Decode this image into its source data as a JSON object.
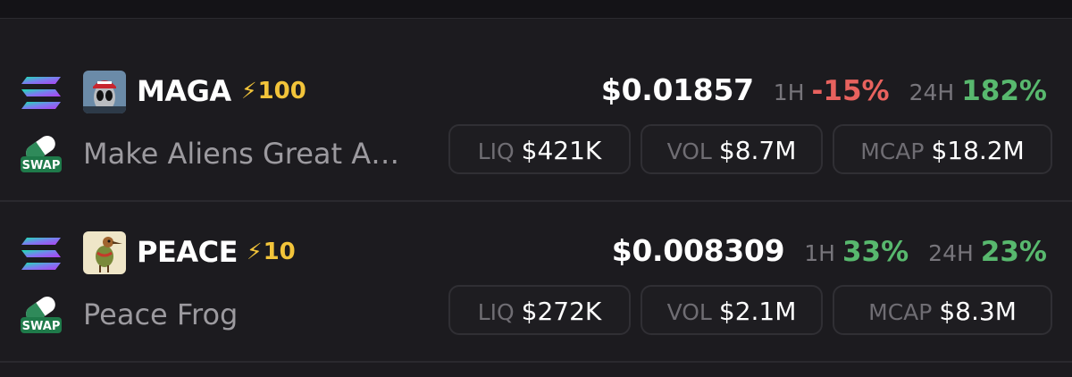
{
  "tokens": [
    {
      "chain_icon": "solana-icon",
      "swap_icon": "swap-pill-icon",
      "swap_label": "SWAP",
      "avatar": "alien-avatar",
      "ticker": "MAGA",
      "boost": "100",
      "name": "Make Aliens Great A…",
      "price": "$0.01857",
      "h1_label": "1H",
      "h1_change": "-15%",
      "h24_label": "24H",
      "h24_change": "182%",
      "liq_label": "LIQ",
      "liq": "$421K",
      "vol_label": "VOL",
      "vol": "$8.7M",
      "mcap_label": "MCAP",
      "mcap": "$18.2M"
    },
    {
      "chain_icon": "solana-icon",
      "swap_icon": "swap-pill-icon",
      "swap_label": "SWAP",
      "avatar": "bird-avatar",
      "ticker": "PEACE",
      "boost": "10",
      "name": "Peace Frog",
      "price": "$0.008309",
      "h1_label": "1H",
      "h1_change": "33%",
      "h24_label": "24H",
      "h24_change": "23%",
      "liq_label": "LIQ",
      "liq": "$272K",
      "vol_label": "VOL",
      "vol": "$2.1M",
      "mcap_label": "MCAP",
      "mcap": "$8.3M"
    }
  ],
  "colors": {
    "background": "#1c1b1f",
    "positive": "#58b86e",
    "negative": "#e8625e",
    "boost": "#f2c43a",
    "muted": "#9c9a9f"
  }
}
